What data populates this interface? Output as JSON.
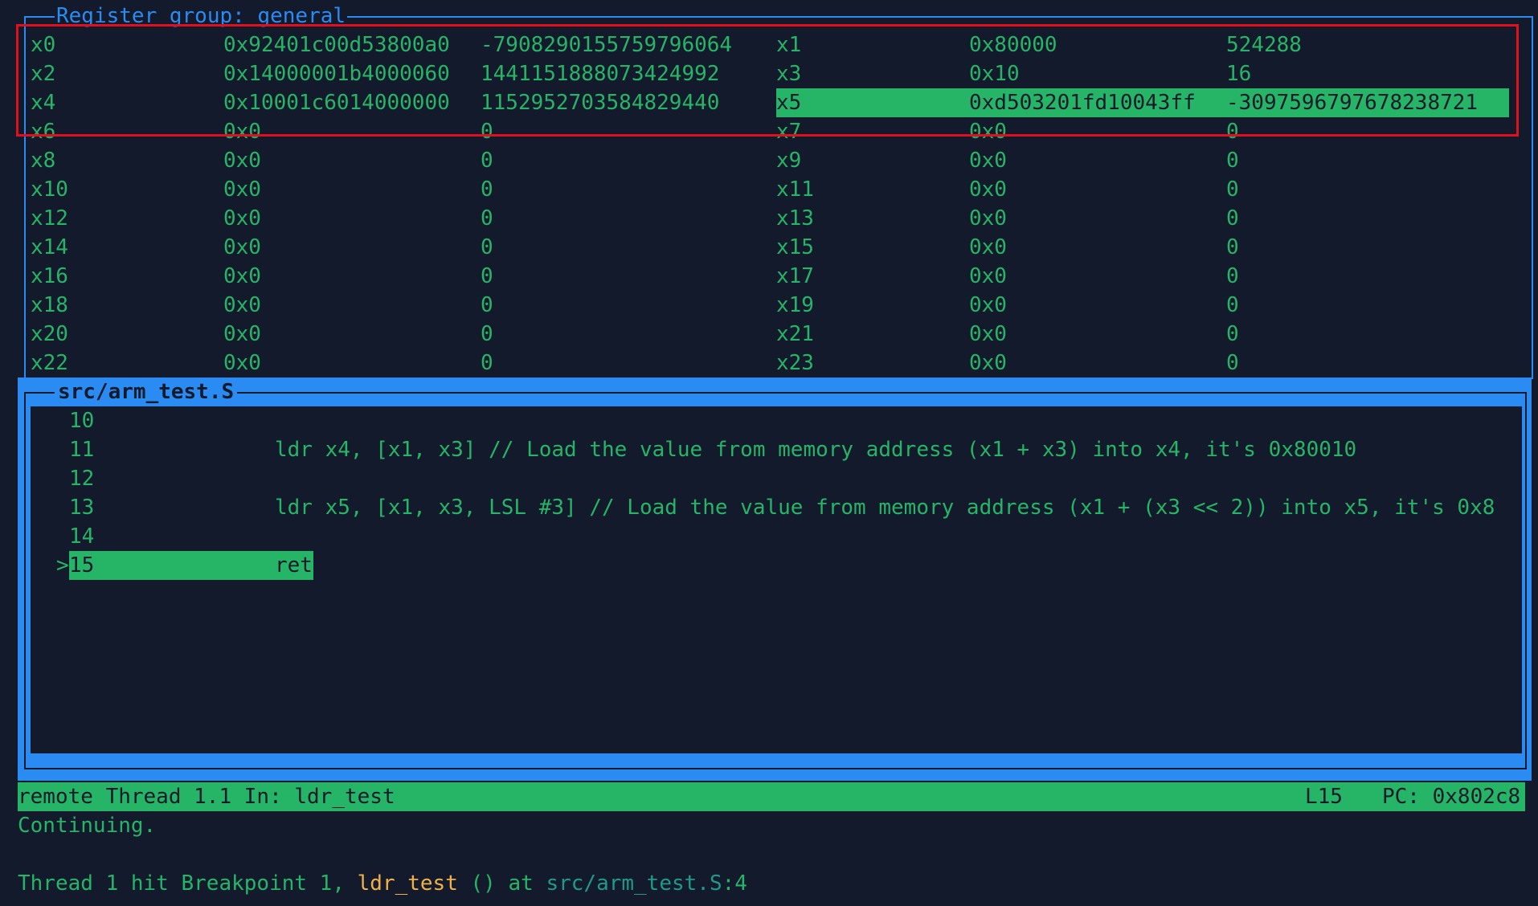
{
  "registers": {
    "title": "Register group: general",
    "rows": [
      {
        "name_a": "x0",
        "hex_a": "0x92401c00d53800a0",
        "dec_a": "-7908290155759796064",
        "name_b": "x1",
        "hex_b": "0x80000",
        "dec_b": "524288"
      },
      {
        "name_a": "x2",
        "hex_a": "0x14000001b4000060",
        "dec_a": "1441151888073424992",
        "name_b": "x3",
        "hex_b": "0x10",
        "dec_b": "16"
      },
      {
        "name_a": "x4",
        "hex_a": "0x10001c6014000000",
        "dec_a": "1152952703584829440",
        "name_b": "x5",
        "hex_b": "0xd503201fd10043ff",
        "dec_b": "-3097596797678238721"
      },
      {
        "name_a": "x6",
        "hex_a": "0x0",
        "dec_a": "0",
        "name_b": "x7",
        "hex_b": "0x0",
        "dec_b": "0"
      },
      {
        "name_a": "x8",
        "hex_a": "0x0",
        "dec_a": "0",
        "name_b": "x9",
        "hex_b": "0x0",
        "dec_b": "0"
      },
      {
        "name_a": "x10",
        "hex_a": "0x0",
        "dec_a": "0",
        "name_b": "x11",
        "hex_b": "0x0",
        "dec_b": "0"
      },
      {
        "name_a": "x12",
        "hex_a": "0x0",
        "dec_a": "0",
        "name_b": "x13",
        "hex_b": "0x0",
        "dec_b": "0"
      },
      {
        "name_a": "x14",
        "hex_a": "0x0",
        "dec_a": "0",
        "name_b": "x15",
        "hex_b": "0x0",
        "dec_b": "0"
      },
      {
        "name_a": "x16",
        "hex_a": "0x0",
        "dec_a": "0",
        "name_b": "x17",
        "hex_b": "0x0",
        "dec_b": "0"
      },
      {
        "name_a": "x18",
        "hex_a": "0x0",
        "dec_a": "0",
        "name_b": "x19",
        "hex_b": "0x0",
        "dec_b": "0"
      },
      {
        "name_a": "x20",
        "hex_a": "0x0",
        "dec_a": "0",
        "name_b": "x21",
        "hex_b": "0x0",
        "dec_b": "0"
      },
      {
        "name_a": "x22",
        "hex_a": "0x0",
        "dec_a": "0",
        "name_b": "x23",
        "hex_b": "0x0",
        "dec_b": "0"
      }
    ]
  },
  "source": {
    "title": "src/arm_test.S",
    "current_marker": ">",
    "lines": [
      {
        "num": "10",
        "code": ""
      },
      {
        "num": "11",
        "code": "ldr x4, [x1, x3] // Load the value from memory address (x1 + x3) into x4, it's 0x80010"
      },
      {
        "num": "12",
        "code": ""
      },
      {
        "num": "13",
        "code": "ldr x5, [x1, x3, LSL #3] // Load the value from memory address (x1 + (x3 << 2)) into x5, it's 0x8"
      },
      {
        "num": "14",
        "code": ""
      },
      {
        "num": "15",
        "code": "ret"
      }
    ]
  },
  "status": {
    "left": "remote Thread 1.1 In: ldr_test",
    "line": "L15",
    "pc": "PC: 0x802c8"
  },
  "console": {
    "line1": "Continuing.",
    "line3_prefix": "Thread 1 hit Breakpoint 1, ",
    "line3_fn": "ldr_test",
    "line3_mid": " () at ",
    "line3_path": "src/arm_test.S",
    "line3_suffix": ":4"
  },
  "colors": {
    "background": "#131a2b",
    "text_green": "#26b566",
    "panel_blue": "#2a8bf2",
    "annotation_red": "#e0101e",
    "function_orange": "#f0b14a"
  }
}
